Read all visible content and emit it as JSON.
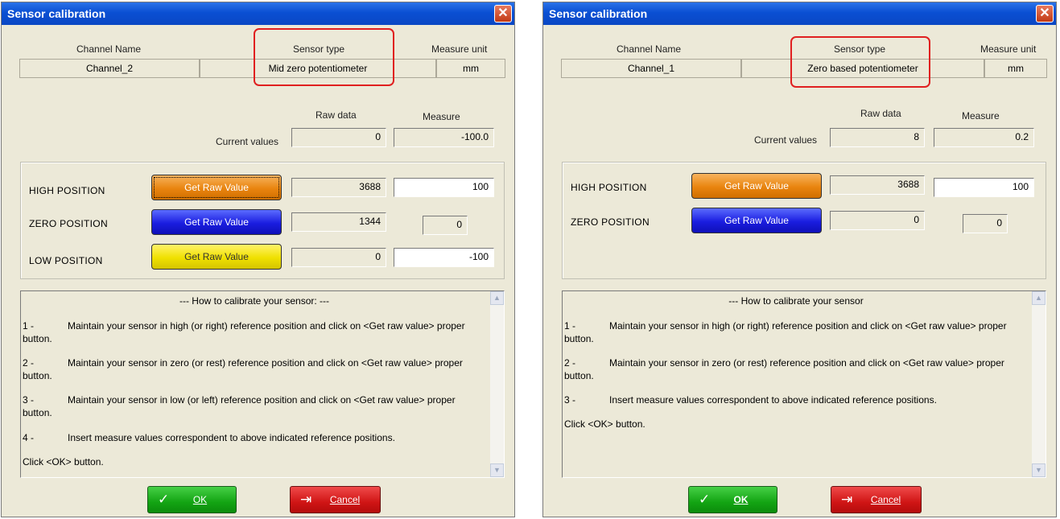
{
  "labels": {
    "channel_name": "Channel Name",
    "sensor_type": "Sensor type",
    "measure_unit": "Measure unit",
    "raw_data": "Raw data",
    "measure": "Measure",
    "current_values": "Current values",
    "get_raw_value": "Get Raw Value",
    "high_position": "HIGH POSITION",
    "zero_position": "ZERO POSITION",
    "low_position": "LOW POSITION",
    "ok": "OK",
    "cancel": "Cancel",
    "close_glyph": "✕"
  },
  "colors": {
    "high_button": "#e9840e",
    "zero_button": "#1a1de0",
    "low_button": "#efe000",
    "highlight": "#e02020"
  },
  "icons": {
    "ok": "checkmark-icon",
    "cancel": "exit-door-icon",
    "close": "close-icon"
  },
  "dialogs": [
    {
      "title": "Sensor calibration",
      "channel_name": "Channel_2",
      "sensor_type": "Mid zero potentiometer",
      "measure_unit": "mm",
      "current_raw": "0",
      "current_measure": "-100.0",
      "high": {
        "raw": "3688",
        "measure": "100"
      },
      "zero": {
        "raw": "1344",
        "measure": "0"
      },
      "low": {
        "raw": "0",
        "measure": "-100"
      },
      "instructions": {
        "title": "--- How to calibrate your sensor: ---",
        "s1_num": "1 -",
        "s1_text": "Maintain your sensor in high (or right) reference position and click on <Get raw value> proper",
        "s1_cont": "button.",
        "s2_num": "2 -",
        "s2_text": "Maintain your sensor in zero (or rest) reference position and click on <Get raw value> proper",
        "s2_cont": "button.",
        "s3_num": "3 -",
        "s3_text": "Maintain your sensor in low (or left) reference position and click on <Get raw value> proper",
        "s3_cont": "button.",
        "s4_num": "4 -",
        "s4_text": "Insert measure values correspondent to above indicated reference positions.",
        "footer": "Click <OK> button."
      }
    },
    {
      "title": "Sensor calibration",
      "channel_name": "Channel_1",
      "sensor_type": "Zero based potentiometer",
      "measure_unit": "mm",
      "current_raw": "8",
      "current_measure": "0.2",
      "high": {
        "raw": "3688",
        "measure": "100"
      },
      "zero": {
        "raw": "0",
        "measure": "0"
      },
      "instructions": {
        "title": "--- How to calibrate your sensor",
        "s1_num": "1 -",
        "s1_text": "Maintain your sensor in high (or right) reference position and click on <Get raw value> proper",
        "s1_cont": "button.",
        "s2_num": "2 -",
        "s2_text": "Maintain your sensor in zero (or rest) reference position and click on <Get raw value> proper",
        "s2_cont": "button.",
        "s3_num": "3 -",
        "s3_text": "Insert measure values correspondent to above indicated reference positions.",
        "footer": "Click <OK> button."
      }
    }
  ]
}
